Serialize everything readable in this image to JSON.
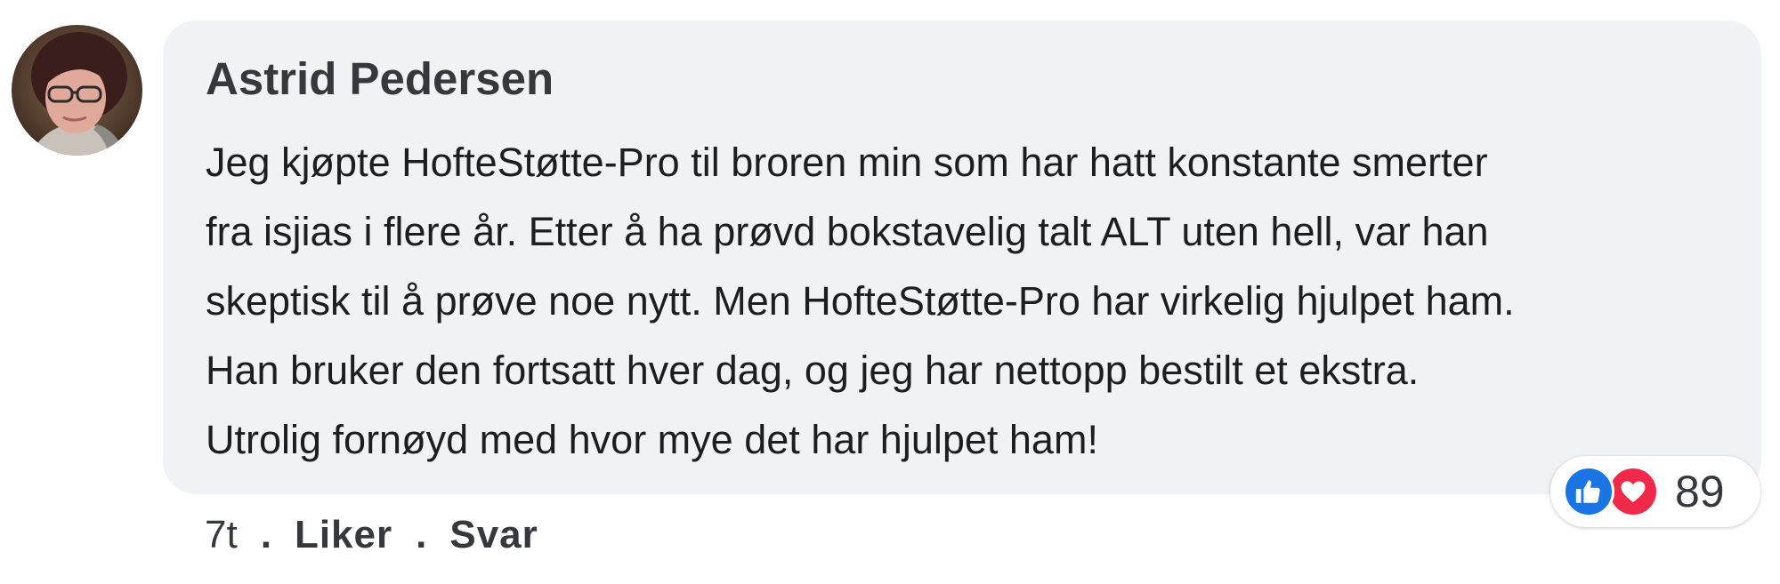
{
  "comment": {
    "author": "Astrid Pedersen",
    "avatar_alt": "profile-photo",
    "body_lines": [
      "Jeg kjøpte HofteStøtte-Pro til broren min som har hatt konstante smerter",
      "fra isjias i flere år. Etter å ha prøvd bokstavelig talt ALT uten hell, var han",
      "skeptisk til å prøve noe nytt. Men HofteStøtte-Pro har virkelig hjulpet ham.",
      "Han bruker den fortsatt hver dag, og jeg har nettopp bestilt et ekstra.",
      "Utrolig fornøyd med hvor mye det har hjulpet ham!"
    ],
    "reactions": {
      "icons": [
        "like-icon",
        "love-icon"
      ],
      "count": "89",
      "like_color": "#1b74e4",
      "love_color": "#f0284a"
    },
    "actions": {
      "time": "7t",
      "separator": ".",
      "like_label": "Liker",
      "reply_label": "Svar"
    }
  }
}
